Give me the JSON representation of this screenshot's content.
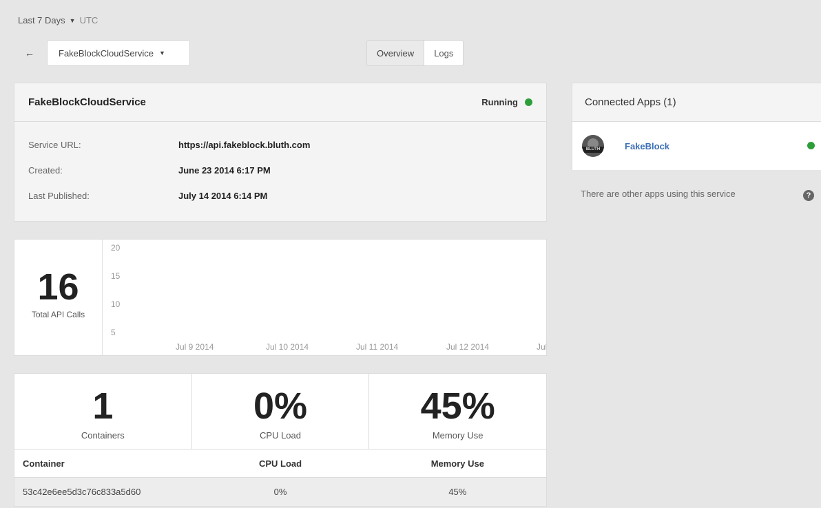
{
  "range": {
    "label": "Last 7 Days",
    "timezone": "UTC"
  },
  "nav": {
    "back_icon": "←",
    "service_selected": "FakeBlockCloudService"
  },
  "tabs": [
    {
      "label": "Overview",
      "active": true
    },
    {
      "label": "Logs",
      "active": false
    }
  ],
  "service": {
    "name": "FakeBlockCloudService",
    "status": "Running",
    "status_color": "#2e9e3a",
    "details": [
      {
        "label": "Service URL:",
        "value": "https://api.fakeblock.bluth.com"
      },
      {
        "label": "Created:",
        "value": "June 23 2014 6:17 PM"
      },
      {
        "label": "Last Published:",
        "value": "July 14 2014 6:14 PM"
      }
    ]
  },
  "api_calls": {
    "total": "16",
    "label": "Total API Calls"
  },
  "chart_data": {
    "type": "line",
    "y_ticks": [
      "20",
      "15",
      "10",
      "5"
    ],
    "x_ticks": [
      "Jul 9 2014",
      "Jul 10 2014",
      "Jul 11 2014",
      "Jul 12 2014",
      "Jul"
    ],
    "ylim": [
      5,
      20
    ],
    "series": []
  },
  "stats": [
    {
      "value": "1",
      "label": "Containers"
    },
    {
      "value": "0%",
      "label": "CPU Load"
    },
    {
      "value": "45%",
      "label": "Memory Use"
    }
  ],
  "table": {
    "headers": [
      "Container",
      "CPU Load",
      "Memory Use"
    ],
    "rows": [
      [
        "53c42e6ee5d3c76c833a5d60",
        "0%",
        "45%"
      ]
    ]
  },
  "apps": {
    "title": "Connected Apps (1)",
    "items": [
      {
        "name": "FakeBlock",
        "avatar_text": "BLUTH",
        "status_color": "#2e9e3a"
      }
    ],
    "note": "There are other apps using this service",
    "help_icon": "?"
  }
}
